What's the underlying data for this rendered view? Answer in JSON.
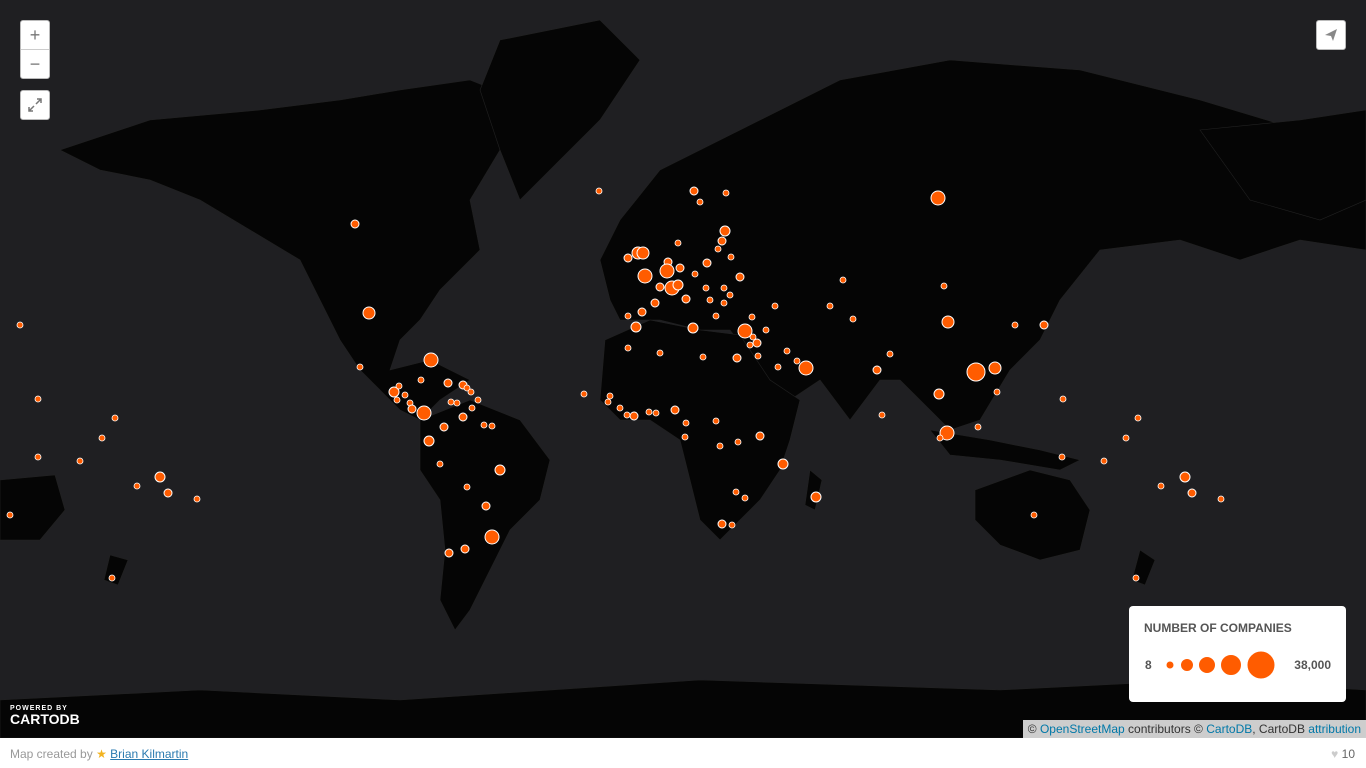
{
  "controls": {
    "zoom_in": "+",
    "zoom_out": "−",
    "fullscreen_icon": "fullscreen-icon",
    "share_icon": "paper-plane-icon"
  },
  "legend": {
    "title": "NUMBER OF COMPANIES",
    "min_label": "8",
    "max_label": "38,000",
    "fill_color": "#ff5c00"
  },
  "attribution": {
    "prefix": "©",
    "osm": "OpenStreetMap",
    "contributors": "contributors ©",
    "cartodb": "CartoDB",
    "cartodb_plain": ", CartoDB",
    "attribution_link": "attribution"
  },
  "powered_by": {
    "small": "POWERED BY",
    "brand": "CARTODB"
  },
  "footer": {
    "credit_prefix": "Map created by",
    "author": "Brian Kilmartin",
    "likes": "10"
  },
  "colors": {
    "ocean": "#1f1f22",
    "land": "#050505",
    "bubble": "#ff5c00",
    "bubble_stroke": "#ffffff"
  }
}
